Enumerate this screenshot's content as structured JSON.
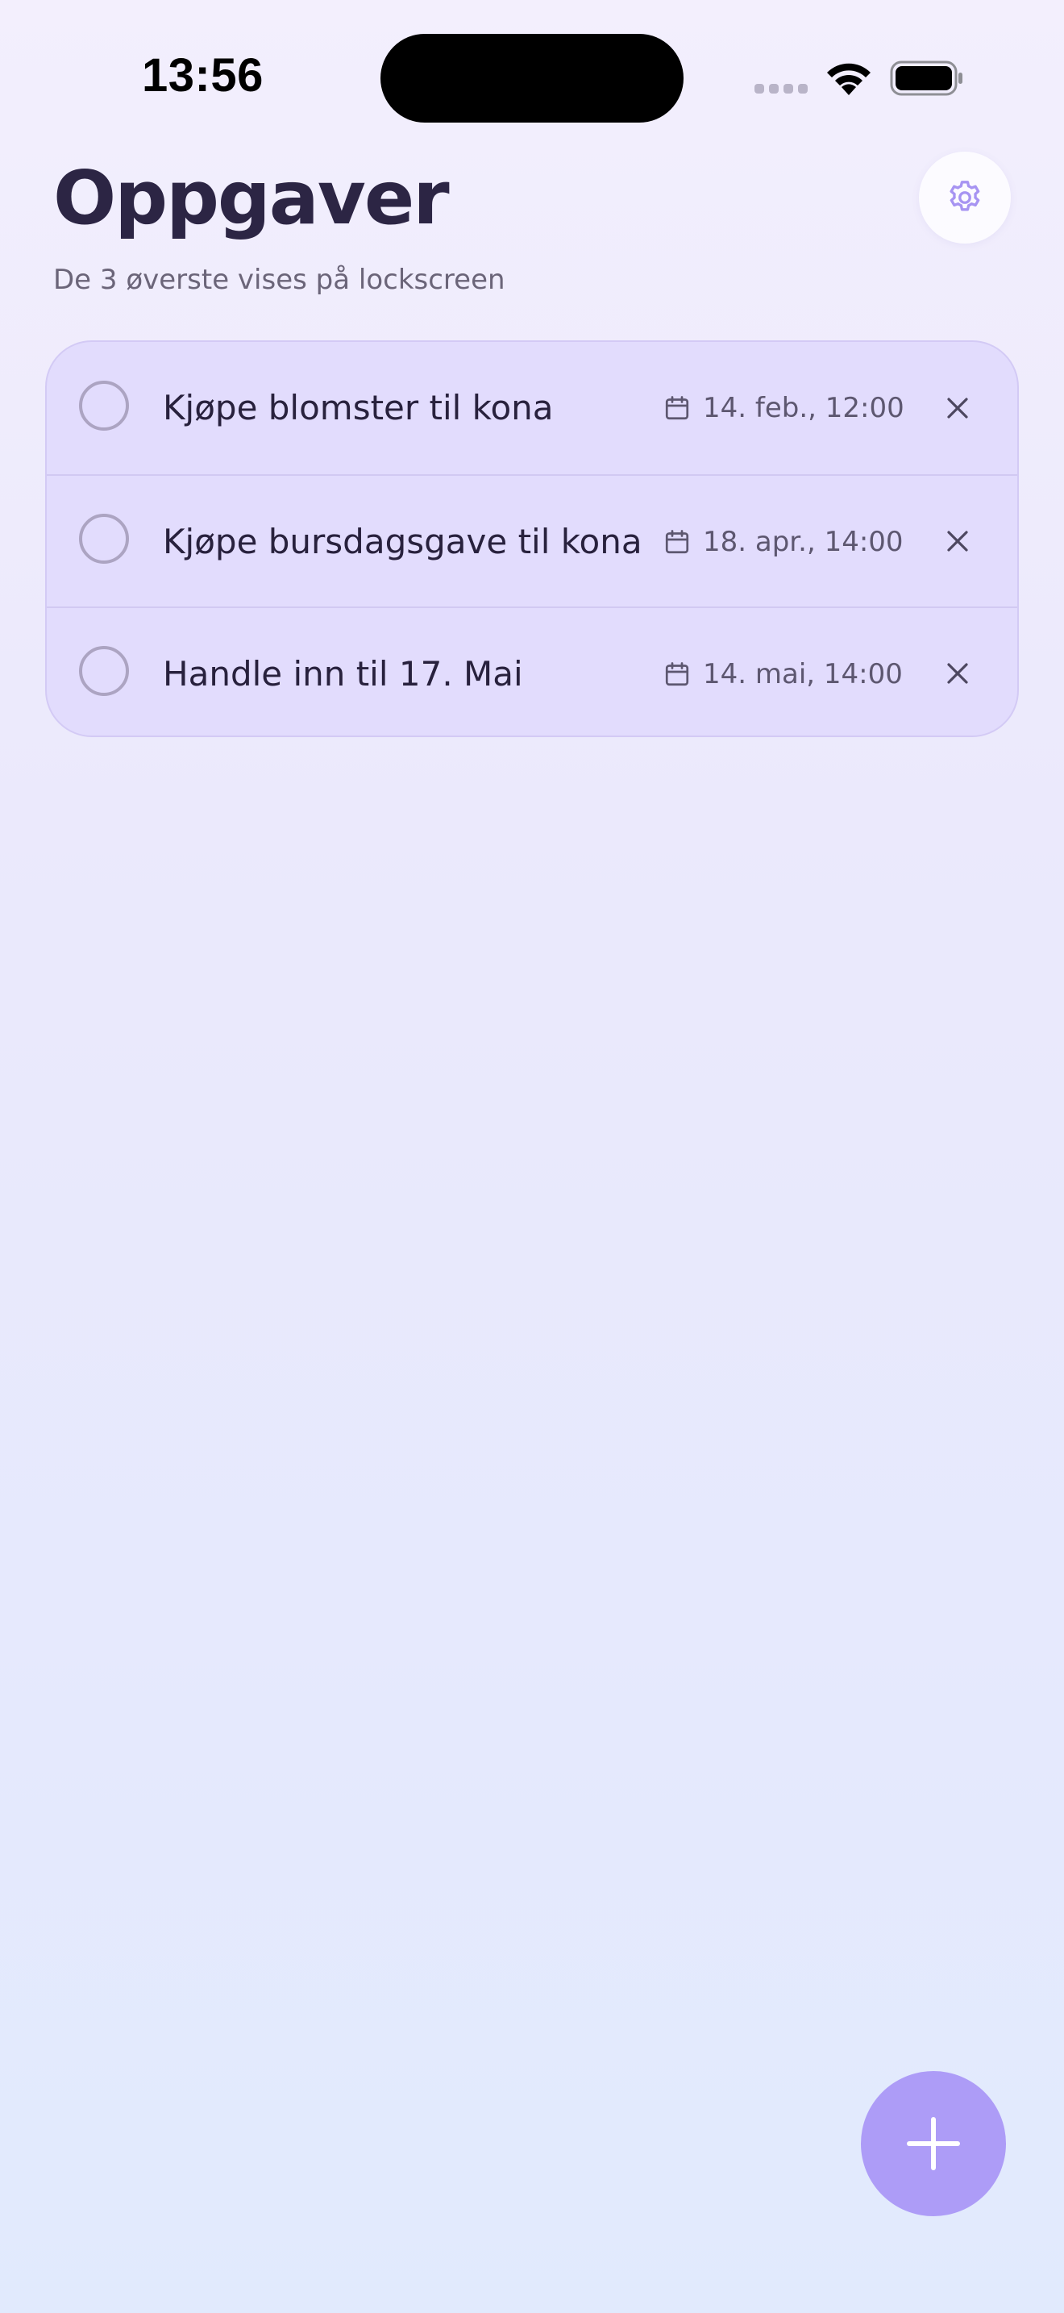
{
  "status_bar": {
    "time": "13:56"
  },
  "header": {
    "title": "Oppgaver",
    "subtitle": "De 3 øverste vises på lockscreen",
    "settings_icon": "gear-icon"
  },
  "tasks": [
    {
      "title": "Kjøpe blomster til kona",
      "date": "14. feb., 12:00",
      "completed": false
    },
    {
      "title": "Kjøpe bursdagsgave til kona",
      "date": "18. apr., 14:00",
      "completed": false
    },
    {
      "title": "Handle inn til 17. Mai",
      "date": "14. mai, 14:00",
      "completed": false
    }
  ],
  "fab": {
    "icon": "plus-icon"
  },
  "colors": {
    "accent": "#ad9cf7",
    "card_background": "#e2dcfd",
    "title_text": "#2c2544"
  }
}
